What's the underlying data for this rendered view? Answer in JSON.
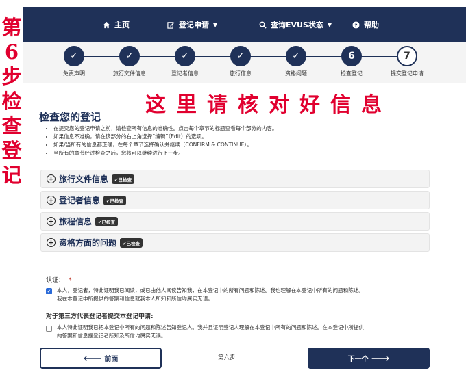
{
  "annotations": {
    "side_chars": [
      "第",
      "6",
      "步",
      "检",
      "查",
      "登",
      "记"
    ],
    "banner": "这里请核对好信息"
  },
  "nav": {
    "home": "主页",
    "registration": "登记申请",
    "status": "查询EVUS状态",
    "help": "帮助"
  },
  "steps": [
    {
      "mark": "✓",
      "label": "免责声明",
      "state": "done"
    },
    {
      "mark": "✓",
      "label": "旅行文件信息",
      "state": "done"
    },
    {
      "mark": "✓",
      "label": "登记者信息",
      "state": "done"
    },
    {
      "mark": "✓",
      "label": "旅行信息",
      "state": "done"
    },
    {
      "mark": "✓",
      "label": "资格问题",
      "state": "done"
    },
    {
      "mark": "6",
      "label": "检查登记",
      "state": "current"
    },
    {
      "mark": "7",
      "label": "提交登记申请",
      "state": "pending"
    }
  ],
  "main": {
    "title": "检查您的登记",
    "instructions": [
      "在提交您的登记申请之前，请检查所有信息的准确性。点击每个章节的标题查看每个部分的内容。",
      "如果信息不准确，请在该部分的右上角选择“编辑”（Edit）的选项。",
      "如果/当所有的信息都正确，在每个章节选择确认并继续（CONFIRM & CONTINUE）。",
      "当所有的章节经过检查之后，您将可以继续进行下一步。"
    ],
    "sections": [
      {
        "title": "旅行文件信息",
        "badge": "✔已检查"
      },
      {
        "title": "登记者信息",
        "badge": "✔已检查"
      },
      {
        "title": "旅程信息",
        "badge": "✔已检查"
      },
      {
        "title": "资格方面的问题",
        "badge": "✔已检查"
      }
    ]
  },
  "certification": {
    "label": "认证：",
    "required_mark": "*",
    "self_checked": true,
    "self_text_1": "本人，登记者，特此证明我已阅读，或已由他人阅读告知我，在本登记中的所有问题和陈述。我也理解在本登记中所有的问题和陈述。",
    "self_text_2": "我在本登记中所提供的答案和信息就我本人所知和所信均属实无误。",
    "third_party_label": "对于第三方代表登记者提交本登记申请:",
    "third_checked": false,
    "third_text_1": "本人特此证明我已把本登记中所有的问题和陈述告知登记人。我并且证明登记人理解在本登记中所有的问题和陈述。在本登记中所提供",
    "third_text_2": "的答案和信息据登记者所知及所信均属实无误。"
  },
  "footer": {
    "prev": "前面",
    "step": "第六步",
    "next": "下一个"
  }
}
